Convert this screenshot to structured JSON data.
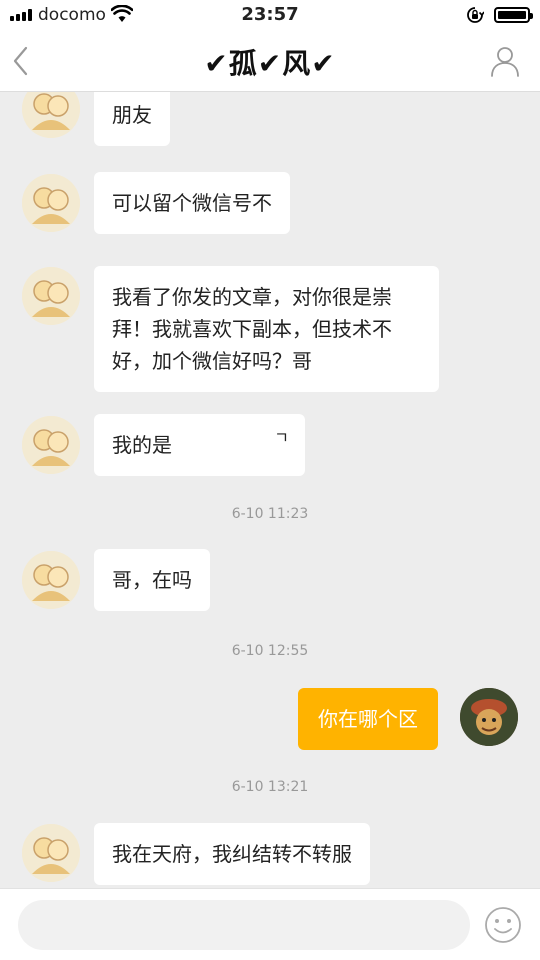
{
  "status_bar": {
    "carrier": "docomo",
    "time": "23:57"
  },
  "nav": {
    "title": "✔孤✔风✔"
  },
  "messages": [
    {
      "side": "in",
      "text": "朋友"
    },
    {
      "side": "in",
      "text": "可以留个微信号不"
    },
    {
      "side": "in",
      "lines": [
        "我看了你发的文章，对你很是崇",
        "拜！我就喜欢下副本，但技术不",
        "好，加个微信好吗？哥"
      ]
    },
    {
      "side": "in",
      "text": "我的是",
      "tail": "ㄱ"
    },
    {
      "side": "time",
      "text": "6-10 11:23"
    },
    {
      "side": "in",
      "text": "哥，在吗"
    },
    {
      "side": "time",
      "text": "6-10 12:55"
    },
    {
      "side": "out",
      "text": "你在哪个区"
    },
    {
      "side": "time",
      "text": "6-10 13:21"
    },
    {
      "side": "in",
      "text": "我在天府，我纠结转不转服"
    }
  ],
  "input": {
    "value": ""
  },
  "colors": {
    "outgoing_bubble": "#ffb300",
    "incoming_bubble": "#ffffff",
    "background": "#ededed"
  },
  "icons": [
    "signal-icon",
    "wifi-icon",
    "orientation-lock-icon",
    "battery-icon",
    "back-chevron-icon",
    "profile-icon",
    "emoji-icon"
  ]
}
